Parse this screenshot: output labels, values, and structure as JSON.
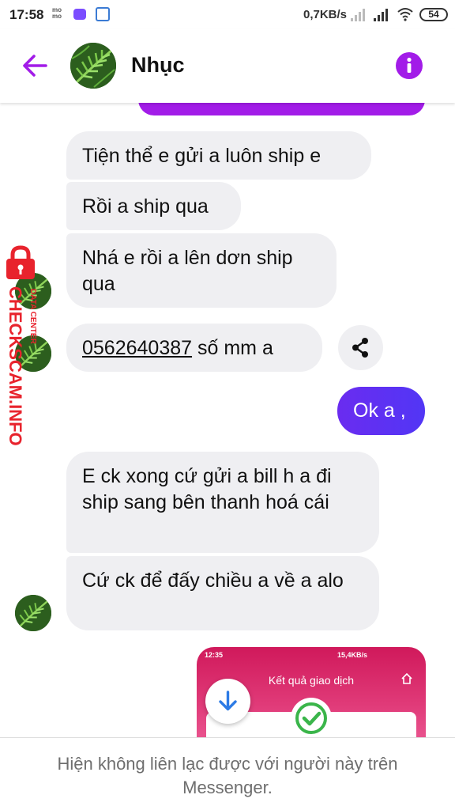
{
  "status_bar": {
    "time": "17:58",
    "momo_label": "mo mo",
    "network_speed": "0,7KB/s",
    "battery": "54"
  },
  "header": {
    "title": "Nhục",
    "accent_color": "#a21ce8"
  },
  "messages": {
    "incoming": [
      "Tiện thể e gửi a luôn ship e",
      "Rồi a ship qua",
      "Nhá e rồi a lên dơn ship qua",
      "E ck xong cứ gửi a bill h a đi ship sang bên thanh hoá cái",
      "Cứ ck để đấy chiều a về a alo"
    ],
    "phone_message": {
      "phone": "0562640387",
      "rest": " số mm a"
    },
    "outgoing": [
      "Ok a ,"
    ]
  },
  "watermark": {
    "text": "CHECKSCAM.INFO",
    "sub": "DATA CENTER"
  },
  "attachment": {
    "time": "12:35",
    "speed": "15,4KB/s",
    "title": "Kết quả giao dịch"
  },
  "footer": {
    "text": "Hiện không liên lạc được với người này trên Messenger."
  },
  "icons": [
    "back-arrow-icon",
    "info-icon",
    "share-icon",
    "arrow-down-icon",
    "checkmark-icon",
    "lock-icon",
    "home-icon",
    "wifi-icon",
    "signal-icon",
    "battery-icon"
  ]
}
